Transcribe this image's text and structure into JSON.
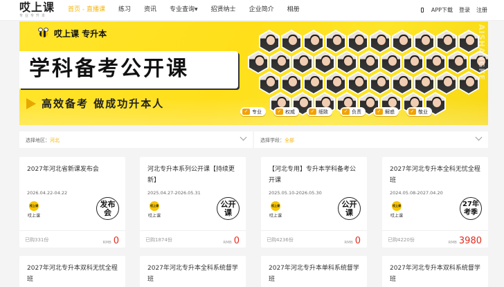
{
  "header": {
    "logo_main": "哎上课",
    "logo_sub": "专业专升本",
    "nav": [
      "首页 - 直播课",
      "练习",
      "资讯",
      "专业查询▾",
      "招贤纳士",
      "企业简介",
      "相册"
    ],
    "app_download": "APP下载",
    "login": "登录",
    "register": "注册"
  },
  "banner": {
    "brand": "哎上课 专升本",
    "title": "学科备考公开课",
    "slogan": "高效备考 做成功升本人",
    "side_text": "AISHANGKE",
    "tags": [
      "专业",
      "权威",
      "细致",
      "负责",
      "解惑",
      "敬业"
    ]
  },
  "filters": {
    "region_label": "选择地区：",
    "region_value": "河北",
    "stage_label": "选择学段：",
    "stage_value": "全部"
  },
  "courses": [
    {
      "title": "2027年河北省新课发布会",
      "date": "2026.04.22-04.22",
      "teacher": "哎上课",
      "badge": "发布会",
      "sold": "已购331份",
      "currency": "RMB",
      "price": "0"
    },
    {
      "title": "河北专升本系列公开课【持续更新】",
      "date": "2025.04.27-2026.05.31",
      "teacher": "哎上课",
      "badge": "公开课",
      "sold": "已购1874份",
      "currency": "RMB",
      "price": "0"
    },
    {
      "title": "【河北专用】专升本学科备考公开课",
      "date": "2025.05.10-2026.05.30",
      "teacher": "哎上课",
      "badge": "公开课",
      "sold": "已购4236份",
      "currency": "RMB",
      "price": "0"
    },
    {
      "title": "2027年河北专升本全科无忧全程班",
      "date": "2024.05.08-2027.04.20",
      "teacher": "哎上课",
      "badge": "27年考季",
      "sold": "已购4220份",
      "currency": "RMB",
      "price": "3980"
    },
    {
      "title": "2027年河北专升本双科无忧全程班"
    },
    {
      "title": "2027年河北专升本全科系统督学班"
    },
    {
      "title": "2027年河北专升本单科系统督学班"
    },
    {
      "title": "2027年河北专升本双科系统督学班"
    }
  ]
}
